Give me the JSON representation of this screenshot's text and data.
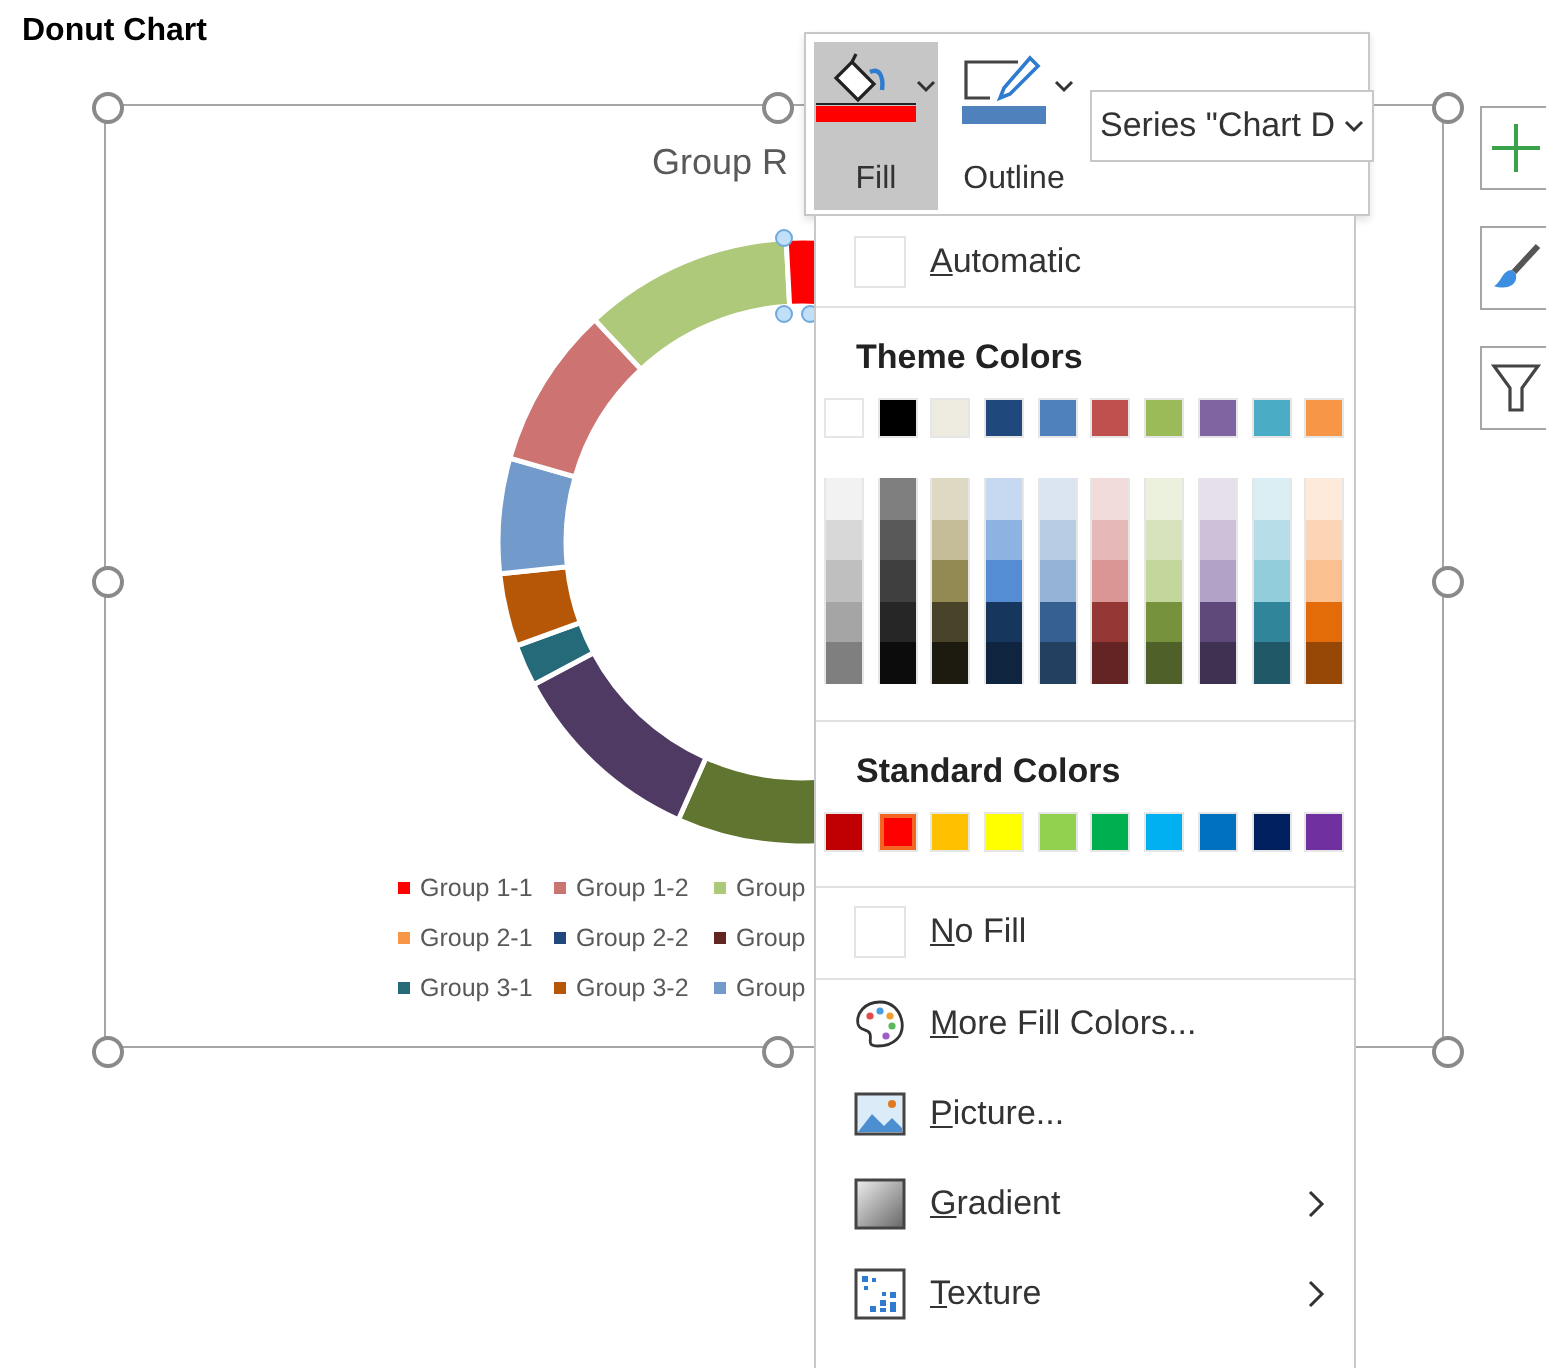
{
  "document": {
    "title": "Donut Chart"
  },
  "chart": {
    "title": "Group R",
    "legend": [
      {
        "label": "Group 1-1",
        "color": "#ff0000"
      },
      {
        "label": "Group 1-2",
        "color": "#cd7371"
      },
      {
        "label": "Group",
        "color": "#aec97a"
      },
      {
        "label": "Group 2-1",
        "color": "#f79646"
      },
      {
        "label": "Group 2-2",
        "color": "#1f497d"
      },
      {
        "label": "Group",
        "color": "#632523"
      },
      {
        "label": "Group 3-1",
        "color": "#266a78"
      },
      {
        "label": "Group 3-2",
        "color": "#b65708"
      },
      {
        "label": "Group",
        "color": "#729aca"
      }
    ]
  },
  "ribbon": {
    "buttons": [
      {
        "label": "Fill",
        "kind": "fill",
        "selected": true
      },
      {
        "label": "Outline",
        "kind": "outline",
        "selected": false
      }
    ],
    "series_dropdown": {
      "value": "Series \"Chart D"
    }
  },
  "fill_menu": {
    "automatic": {
      "label": "Automatic"
    },
    "theme_colors_heading": "Theme Colors",
    "theme_colors": [
      {
        "color": "#ffffff"
      },
      {
        "color": "#000000"
      },
      {
        "color": "#eeece1"
      },
      {
        "color": "#1f497d"
      },
      {
        "color": "#4f81bd"
      },
      {
        "color": "#c0504d"
      },
      {
        "color": "#9bbb59"
      },
      {
        "color": "#8064a2"
      },
      {
        "color": "#4bacc6"
      },
      {
        "color": "#f79646"
      }
    ],
    "theme_shades": [
      {
        "colors": [
          {
            "color": "#f2f2f2"
          },
          {
            "color": "#7f7f7f"
          },
          {
            "color": "#ddd9c3"
          },
          {
            "color": "#c6d9f0"
          },
          {
            "color": "#dbe5f1"
          },
          {
            "color": "#f2dcdb"
          },
          {
            "color": "#ebf1dd"
          },
          {
            "color": "#e5e0ec"
          },
          {
            "color": "#dbeef3"
          },
          {
            "color": "#fdeada"
          }
        ]
      },
      {
        "colors": [
          {
            "color": "#d8d8d8"
          },
          {
            "color": "#595959"
          },
          {
            "color": "#c4bd97"
          },
          {
            "color": "#8db3e2"
          },
          {
            "color": "#b8cce4"
          },
          {
            "color": "#e5b9b7"
          },
          {
            "color": "#d7e3bc"
          },
          {
            "color": "#ccc1d9"
          },
          {
            "color": "#b7dde8"
          },
          {
            "color": "#fbd5b5"
          }
        ]
      },
      {
        "colors": [
          {
            "color": "#bfbfbf"
          },
          {
            "color": "#3f3f3f"
          },
          {
            "color": "#938953"
          },
          {
            "color": "#548dd4"
          },
          {
            "color": "#95b3d7"
          },
          {
            "color": "#d99694"
          },
          {
            "color": "#c3d69b"
          },
          {
            "color": "#b2a2c7"
          },
          {
            "color": "#92cddc"
          },
          {
            "color": "#fac08f"
          }
        ]
      },
      {
        "colors": [
          {
            "color": "#a5a5a5"
          },
          {
            "color": "#262626"
          },
          {
            "color": "#494429"
          },
          {
            "color": "#17365d"
          },
          {
            "color": "#366092"
          },
          {
            "color": "#953734"
          },
          {
            "color": "#76923c"
          },
          {
            "color": "#5f497a"
          },
          {
            "color": "#31859b"
          },
          {
            "color": "#e36c09"
          }
        ]
      },
      {
        "colors": [
          {
            "color": "#7f7f7f"
          },
          {
            "color": "#0c0c0c"
          },
          {
            "color": "#1d1b10"
          },
          {
            "color": "#0f243e"
          },
          {
            "color": "#244061"
          },
          {
            "color": "#632423"
          },
          {
            "color": "#4f6128"
          },
          {
            "color": "#3f3151"
          },
          {
            "color": "#205867"
          },
          {
            "color": "#974806"
          }
        ]
      }
    ],
    "standard_colors_heading": "Standard Colors",
    "standard_colors": [
      {
        "color": "#c00000",
        "selected": false
      },
      {
        "color": "#ff0000",
        "selected": true
      },
      {
        "color": "#ffc000",
        "selected": false
      },
      {
        "color": "#ffff00",
        "selected": false
      },
      {
        "color": "#92d050",
        "selected": false
      },
      {
        "color": "#00b050",
        "selected": false
      },
      {
        "color": "#00b0f0",
        "selected": false
      },
      {
        "color": "#0070c0",
        "selected": false
      },
      {
        "color": "#002060",
        "selected": false
      },
      {
        "color": "#7030a0",
        "selected": false
      }
    ],
    "items": [
      {
        "label": "No Fill",
        "kind": "swatch",
        "submenu": false
      },
      {
        "label": "More Fill Colors...",
        "kind": "palette",
        "submenu": false
      },
      {
        "label": "Picture...",
        "kind": "picture",
        "submenu": false
      },
      {
        "label": "Gradient",
        "kind": "gradient",
        "submenu": true
      },
      {
        "label": "Texture",
        "kind": "texture",
        "submenu": true
      }
    ]
  },
  "side_buttons": [
    {
      "kind": "add"
    },
    {
      "kind": "style"
    },
    {
      "kind": "filter"
    }
  ]
}
